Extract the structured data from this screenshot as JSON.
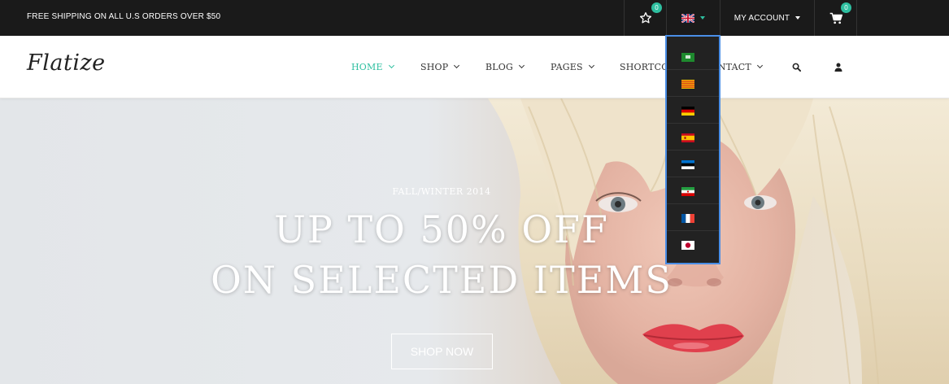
{
  "topbar": {
    "shipping_text": "FREE SHIPPING ON ALL U.S ORDERS OVER $50",
    "wishlist_count": "0",
    "cart_count": "0",
    "account_label": "MY ACCOUNT",
    "current_language": "en",
    "badge_color": "#2ebfa0"
  },
  "header": {
    "logo": "Flatize",
    "nav": [
      {
        "label": "HOME",
        "active": true
      },
      {
        "label": "SHOP"
      },
      {
        "label": "BLOG"
      },
      {
        "label": "PAGES"
      },
      {
        "label": "SHORTCODES"
      },
      {
        "label": "CONTACT"
      }
    ],
    "accent_color": "#2ebfa0"
  },
  "language_dropdown": {
    "options": [
      "ar",
      "ca",
      "de",
      "es",
      "et",
      "fa",
      "fr",
      "ja"
    ]
  },
  "hero": {
    "subtitle": "FALL/WINTER 2014",
    "line1": "UP TO 50% OFF",
    "line2": "ON SELECTED ITEMS",
    "button": "SHOP NOW"
  }
}
